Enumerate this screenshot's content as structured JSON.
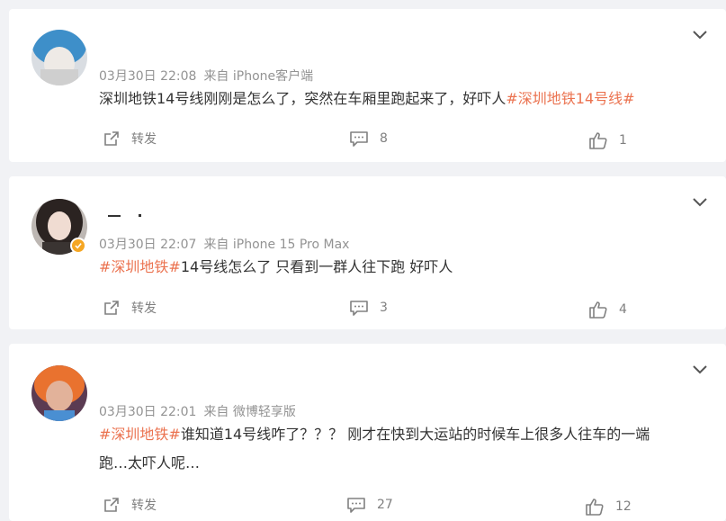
{
  "posts": [
    {
      "time": "03月30日 22:08",
      "source": "来自 iPhone客户端",
      "text": "深圳地铁14号线刚刚是怎么了，突然在车厢里跑起来了，好吓人",
      "text_prefix": "",
      "tag": "#深圳地铁14号线#",
      "tag_position": "end",
      "repost_label": "转发",
      "comment_count": "8",
      "like_count": "1"
    },
    {
      "time": "03月30日 22:07",
      "source": "来自 iPhone 15 Pro Max",
      "tag": "#深圳地铁#",
      "text": "14号线怎么了 只看到一群人往下跑 好吓人",
      "repost_label": "转发",
      "comment_count": "3",
      "like_count": "4"
    },
    {
      "time": "03月30日 22:01",
      "source": "来自 微博轻享版",
      "tag": "#深圳地铁#",
      "text_line1": "谁知道14号线咋了？？？ 刚才在快到大运站的时候车上很多人往车的一端",
      "text_line2": "跑…太吓人呢…",
      "repost_label": "转发",
      "comment_count": "27",
      "like_count": "12"
    }
  ],
  "icons": {
    "repost": "share-arrow-icon",
    "comment": "comment-bubble-icon",
    "like": "thumb-up-icon",
    "menu": "chevron-down-icon",
    "verified": "verified-badge-icon"
  },
  "colors": {
    "tag": "#eb7350",
    "meta": "#939393",
    "badge": "#f5a623",
    "background": "#f1f2f5"
  }
}
